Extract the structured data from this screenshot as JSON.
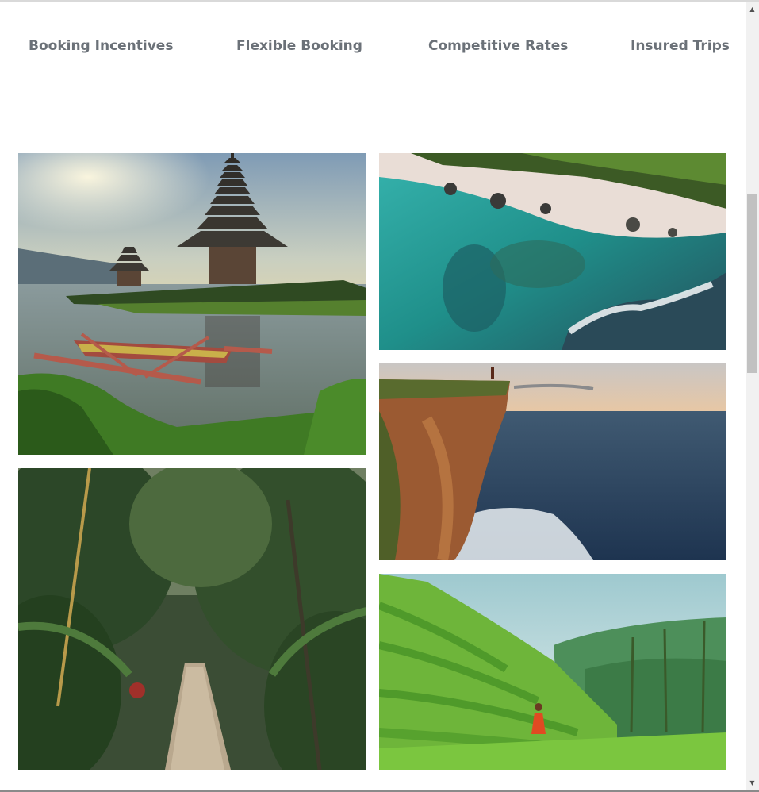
{
  "features": [
    {
      "label": "Booking Incentives"
    },
    {
      "label": "Flexible Booking"
    },
    {
      "label": "Competitive Rates"
    },
    {
      "label": "Insured Trips"
    }
  ],
  "icons": {
    "scroll_up": "triangle-up-icon",
    "scroll_down": "triangle-down-icon"
  },
  "colors": {
    "feature_text": "#6b7178",
    "scroll_track": "#f1f1f1",
    "scroll_thumb": "#c1c1c1"
  }
}
